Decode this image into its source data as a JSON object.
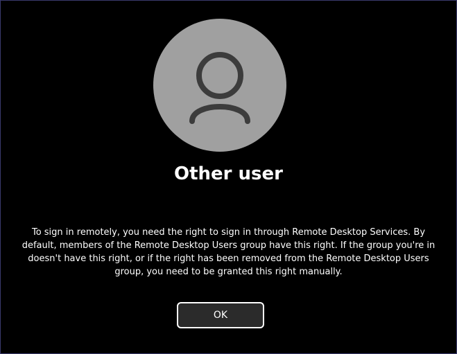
{
  "account": {
    "avatar_icon": "person-icon",
    "user_name": "Other user"
  },
  "message": {
    "lines": [
      "To sign in remotely, you need the right to sign in through Remote Desktop Services. By",
      "default, members of the Remote Desktop Users group have this right. If the group you're in",
      "doesn't have this right, or if the right has been removed from the Remote Desktop Users",
      "group, you need to be granted this right manually."
    ]
  },
  "actions": {
    "ok_label": "OK"
  },
  "colors": {
    "background": "#000000",
    "avatar_fill": "#a0a0a0",
    "avatar_glyph": "#3c3c3c",
    "text": "#ffffff",
    "button_fill": "#2b2b2b",
    "button_border": "#ffffff"
  }
}
